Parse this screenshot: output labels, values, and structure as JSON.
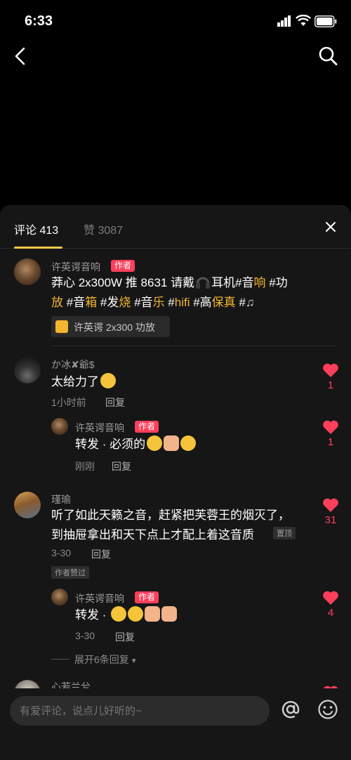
{
  "status": {
    "time": "6:33"
  },
  "tabs": {
    "comments": "评论 413",
    "likes": "赞 3087"
  },
  "comments": [
    {
      "user": "许英谔音响",
      "badge": "作者",
      "text_parts": [
        "莽心 2x300W 推 8631 请戴",
        "耳机#音",
        "响",
        " #功",
        "放",
        " #音",
        "箱",
        " #发",
        "烧",
        " #音",
        "乐",
        " #",
        "hifi",
        " #高",
        "保真",
        " #"
      ],
      "product": "许英谔 2x300 功放"
    },
    {
      "user": "か冰✘爺$",
      "text": "太给力了",
      "time": "1小时前",
      "reply": "回复",
      "likes": "1",
      "sub": {
        "user": "许英谔音响",
        "badge": "作者",
        "text": "转发 · 必须的",
        "time": "刚刚",
        "reply": "回复",
        "likes": "1"
      }
    },
    {
      "user": "瑾瑜",
      "text_line1": "听了如此天籁之音，赶紧把芙蓉王的烟灭了，",
      "text_line2": "到抽屉拿出和天下点上才配上着这音质",
      "pinned": "置顶",
      "time": "3-30",
      "reply": "回复",
      "author_liked": "作者赞过",
      "likes": "31",
      "sub": {
        "user": "许英谔音响",
        "badge": "作者",
        "text": "转发 ·",
        "time": "3-30",
        "reply": "回复",
        "likes": "4"
      },
      "expand": "展开6条回复"
    },
    {
      "user": "心若兰兮"
    }
  ],
  "input": {
    "placeholder": "有爱评论，说点儿好听的~"
  },
  "colors": {
    "accent": "#fd3f5b",
    "highlight": "#f3b630",
    "panel": "#161616"
  }
}
